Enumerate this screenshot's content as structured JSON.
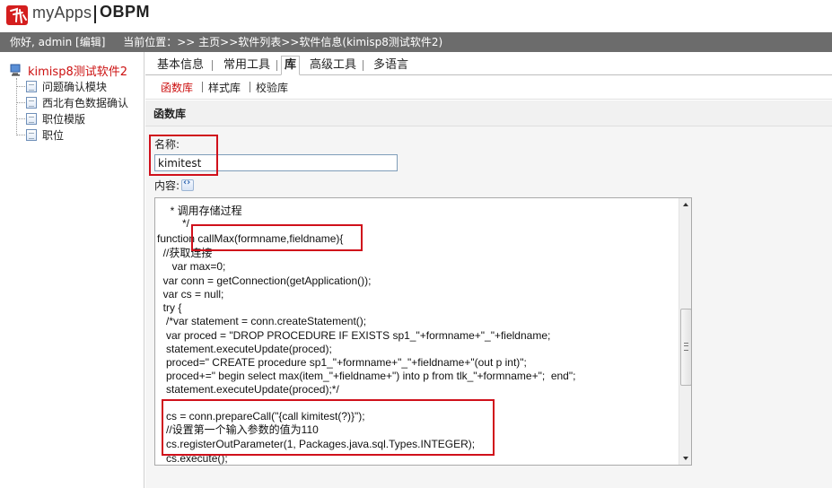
{
  "header": {
    "logo_text": "myApps",
    "product": "OBPM",
    "greeting": "你好, admin [编辑]",
    "location": "当前位置：>> 主页>>软件列表>>软件信息(kimisp8测试软件2)"
  },
  "sidebar": {
    "root_label": "kimisp8测试软件2",
    "items": [
      {
        "label": "问题确认模块"
      },
      {
        "label": "西北有色数据确认"
      },
      {
        "label": "职位模版"
      },
      {
        "label": "职位"
      }
    ]
  },
  "tabs": [
    {
      "label": "基本信息"
    },
    {
      "label": "常用工具"
    },
    {
      "label": "库",
      "active": true
    },
    {
      "label": "高级工具"
    },
    {
      "label": "多语言"
    }
  ],
  "subtabs": [
    {
      "label": "函数库",
      "active": true
    },
    {
      "label": "样式库"
    },
    {
      "label": "校验库"
    }
  ],
  "section_title": "函数库",
  "form": {
    "name_label": "名称:",
    "name_value": "kimitest",
    "content_label": "内容:"
  },
  "code_lines": [
    "  * 调用存储过程",
    "      */",
    "function callMax(formname,fieldname){",
    "  //获取连接",
    "     var max=0;",
    "  var conn = getConnection(getApplication());",
    "  var cs = null;",
    "  try {",
    "   /*var statement = conn.createStatement();",
    "   var proced = \"DROP PROCEDURE IF EXISTS sp1_\"+formname+\"_\"+fieldname;",
    "   statement.executeUpdate(proced);",
    "   proced=\" CREATE procedure sp1_\"+formname+\"_\"+fieldname+\"(out p int)\";",
    "   proced+=\" begin select max(item_\"+fieldname+\") into p from tlk_\"+formname+\";  end\";",
    "   statement.executeUpdate(proced);*/",
    "",
    "   cs = conn.prepareCall(\"{call kimitest(?)}\");",
    "   //设置第一个输入参数的值为110",
    "   cs.registerOutParameter(1, Packages.java.sql.Types.INTEGER);",
    "   cs.execute();"
  ],
  "colors": {
    "status_bar": "#6c6c6c",
    "highlight": "#d0101b",
    "active_link": "#cc1111"
  }
}
